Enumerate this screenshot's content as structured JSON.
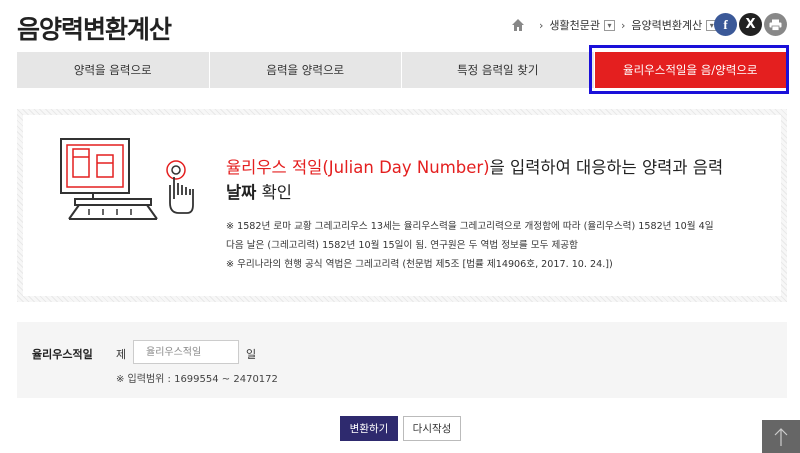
{
  "page": {
    "title": "음양력변환계산"
  },
  "breadcrumb": {
    "home_icon": "home-icon",
    "items": [
      {
        "label": "생활천문관"
      },
      {
        "label": "음양력변환계산"
      }
    ]
  },
  "social": {
    "facebook": "f",
    "twitter": "X",
    "print_icon": "print-icon"
  },
  "tabs": [
    {
      "label": "양력을 음력으로",
      "active": false
    },
    {
      "label": "음력을 양력으로",
      "active": false
    },
    {
      "label": "특정 음력일 찾기",
      "active": false
    },
    {
      "label": "율리우스적일을 음/양력으로",
      "active": true
    }
  ],
  "info": {
    "title_red": "율리우스 적일(Julian Day Number)",
    "title_rest_1": "을 입력하여 대응하는 양력과 음력",
    "title_bold": "날짜",
    "title_rest_2": " 확인",
    "note1": "※ 1582년 로마 교황 그레고리우스 13세는 율리우스력을 그레고리력으로 개정함에 따라 (율리우스력) 1582년 10월 4일",
    "note1b": "다음 날은 (그레고리력) 1582년 10월 15일이 됨. 연구원은 두 역법 정보를 모두 제공함",
    "note2": "※ 우리나라의 현행 공식 역법은 그레고리력 (천문법 제5조 [법률 제14906호, 2017. 10. 24.])"
  },
  "form": {
    "label": "율리우스적일",
    "prefix": "제",
    "placeholder": "율리우스적일",
    "value": "",
    "suffix": "일",
    "range": "※ 입력범위 : 1699554 ~ 2470172"
  },
  "buttons": {
    "convert": "변환하기",
    "reset": "다시작성"
  },
  "colors": {
    "accent_red": "#e41f1f",
    "button_navy": "#2e2a6e",
    "highlight_blue": "#1a10d9"
  }
}
